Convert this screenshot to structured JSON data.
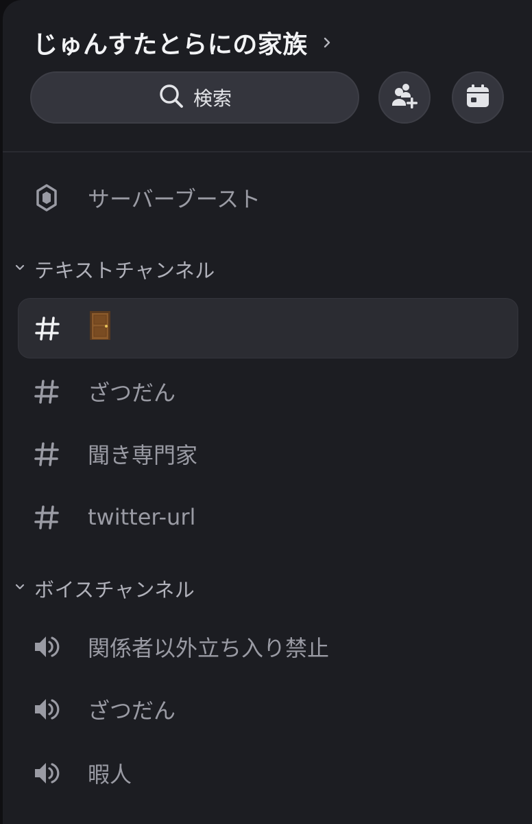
{
  "header": {
    "server_name": "じゅんすたとらにの家族"
  },
  "search": {
    "label": "検索"
  },
  "buttons": {
    "invite": "add-member-icon",
    "events": "calendar-icon"
  },
  "boost": {
    "label": "サーバーブースト"
  },
  "text_category": {
    "label": "テキストチャンネル",
    "channels": [
      {
        "name": "🚪",
        "selected": true
      },
      {
        "name": "ざつだん",
        "selected": false
      },
      {
        "name": "聞き専門家",
        "selected": false
      },
      {
        "name": "twitter-url",
        "selected": false
      }
    ]
  },
  "voice_category": {
    "label": "ボイスチャンネル",
    "channels": [
      {
        "name": "関係者以外立ち入り禁止"
      },
      {
        "name": "ざつだん"
      },
      {
        "name": "暇人"
      }
    ]
  },
  "colors": {
    "panel_bg": "#1c1d22",
    "selected_bg": "#2b2c32",
    "muted_text": "#9a9ba4",
    "bright_text": "#f2f3f5"
  }
}
